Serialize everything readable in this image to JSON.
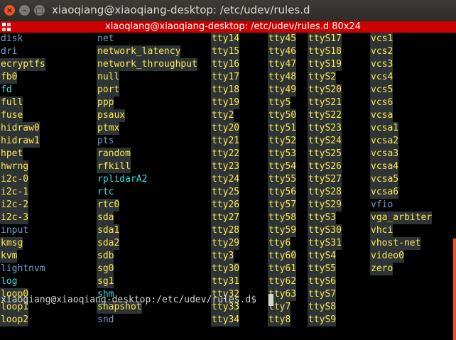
{
  "window": {
    "title": "xiaoqiang@xiaoqiang-desktop: /etc/udev/rules.d",
    "buttons": {
      "close": "×",
      "minimize": "–",
      "maximize": "□"
    }
  },
  "tmux": {
    "title": "xiaoqiang@xiaoqiang-desktop: /etc/udev/rules.d 80x24"
  },
  "listing": {
    "col1": [
      {
        "t": "disk",
        "k": "dir"
      },
      {
        "t": "dri",
        "k": "dir"
      },
      {
        "t": "ecryptfs",
        "k": "dev"
      },
      {
        "t": "fb0",
        "k": "dev"
      },
      {
        "t": "fd",
        "k": "lnk"
      },
      {
        "t": "full",
        "k": "dev"
      },
      {
        "t": "fuse",
        "k": "dev"
      },
      {
        "t": "hidraw0",
        "k": "dev"
      },
      {
        "t": "hidraw1",
        "k": "dev"
      },
      {
        "t": "hpet",
        "k": "dev"
      },
      {
        "t": "hwrng",
        "k": "dev"
      },
      {
        "t": "i2c-0",
        "k": "dev"
      },
      {
        "t": "i2c-1",
        "k": "dev"
      },
      {
        "t": "i2c-2",
        "k": "dev"
      },
      {
        "t": "i2c-3",
        "k": "dev"
      },
      {
        "t": "input",
        "k": "dir"
      },
      {
        "t": "kmsg",
        "k": "dev"
      },
      {
        "t": "kvm",
        "k": "dev"
      },
      {
        "t": "lightnvm",
        "k": "dir"
      },
      {
        "t": "log",
        "k": "lnk"
      },
      {
        "t": "loop0",
        "k": "dev"
      },
      {
        "t": "loop1",
        "k": "dev"
      },
      {
        "t": "loop2",
        "k": "dev"
      }
    ],
    "col2": [
      {
        "t": "net",
        "k": "dir"
      },
      {
        "t": "network_latency",
        "k": "dev"
      },
      {
        "t": "network_throughput",
        "k": "dev"
      },
      {
        "t": "null",
        "k": "dev"
      },
      {
        "t": "port",
        "k": "dev"
      },
      {
        "t": "ppp",
        "k": "dev"
      },
      {
        "t": "psaux",
        "k": "dev"
      },
      {
        "t": "ptmx",
        "k": "dev"
      },
      {
        "t": "pts",
        "k": "dir"
      },
      {
        "t": "random",
        "k": "dev"
      },
      {
        "t": "rfkill",
        "k": "dev"
      },
      {
        "t": "rplidarA2",
        "k": "lnk"
      },
      {
        "t": "rtc",
        "k": "lnk"
      },
      {
        "t": "rtc0",
        "k": "dev"
      },
      {
        "t": "sda",
        "k": "dev"
      },
      {
        "t": "sda1",
        "k": "dev"
      },
      {
        "t": "sda2",
        "k": "dev"
      },
      {
        "t": "sdb",
        "k": "dev"
      },
      {
        "t": "sg0",
        "k": "dev"
      },
      {
        "t": "sg1",
        "k": "dev"
      },
      {
        "t": "shm",
        "k": "lnk"
      },
      {
        "t": "snapshot",
        "k": "dev"
      },
      {
        "t": "snd",
        "k": "dir"
      }
    ],
    "col3": [
      {
        "t": "tty14",
        "k": "dev"
      },
      {
        "t": "tty15",
        "k": "dev"
      },
      {
        "t": "tty16",
        "k": "dev"
      },
      {
        "t": "tty17",
        "k": "dev"
      },
      {
        "t": "tty18",
        "k": "dev"
      },
      {
        "t": "tty19",
        "k": "dev"
      },
      {
        "t": "tty2",
        "k": "dev"
      },
      {
        "t": "tty20",
        "k": "dev"
      },
      {
        "t": "tty21",
        "k": "dev"
      },
      {
        "t": "tty22",
        "k": "dev"
      },
      {
        "t": "tty23",
        "k": "dev"
      },
      {
        "t": "tty24",
        "k": "dev"
      },
      {
        "t": "tty25",
        "k": "dev"
      },
      {
        "t": "tty26",
        "k": "dev"
      },
      {
        "t": "tty27",
        "k": "dev"
      },
      {
        "t": "tty28",
        "k": "dev"
      },
      {
        "t": "tty29",
        "k": "dev"
      },
      {
        "t": "tty3",
        "k": "dev"
      },
      {
        "t": "tty30",
        "k": "dev"
      },
      {
        "t": "tty31",
        "k": "dev"
      },
      {
        "t": "tty32",
        "k": "dev"
      },
      {
        "t": "tty33",
        "k": "dev"
      },
      {
        "t": "tty34",
        "k": "dev"
      }
    ],
    "col4": [
      {
        "t": "tty45",
        "k": "dev"
      },
      {
        "t": "tty46",
        "k": "dev"
      },
      {
        "t": "tty47",
        "k": "dev"
      },
      {
        "t": "tty48",
        "k": "dev"
      },
      {
        "t": "tty49",
        "k": "dev"
      },
      {
        "t": "tty5",
        "k": "dev"
      },
      {
        "t": "tty50",
        "k": "dev"
      },
      {
        "t": "tty51",
        "k": "dev"
      },
      {
        "t": "tty52",
        "k": "dev"
      },
      {
        "t": "tty53",
        "k": "dev"
      },
      {
        "t": "tty54",
        "k": "dev"
      },
      {
        "t": "tty55",
        "k": "dev"
      },
      {
        "t": "tty56",
        "k": "dev"
      },
      {
        "t": "tty57",
        "k": "dev"
      },
      {
        "t": "tty58",
        "k": "dev"
      },
      {
        "t": "tty59",
        "k": "dev"
      },
      {
        "t": "tty6",
        "k": "dev"
      },
      {
        "t": "tty60",
        "k": "dev"
      },
      {
        "t": "tty61",
        "k": "dev"
      },
      {
        "t": "tty62",
        "k": "dev"
      },
      {
        "t": "tty63",
        "k": "dev"
      },
      {
        "t": "tty7",
        "k": "dev"
      },
      {
        "t": "tty8",
        "k": "dev"
      }
    ],
    "col5": [
      {
        "t": "ttyS17",
        "k": "dev"
      },
      {
        "t": "ttyS18",
        "k": "dev"
      },
      {
        "t": "ttyS19",
        "k": "dev"
      },
      {
        "t": "ttyS2",
        "k": "dev"
      },
      {
        "t": "ttyS20",
        "k": "dev"
      },
      {
        "t": "ttyS21",
        "k": "dev"
      },
      {
        "t": "ttyS22",
        "k": "dev"
      },
      {
        "t": "ttyS23",
        "k": "dev"
      },
      {
        "t": "ttyS24",
        "k": "dev"
      },
      {
        "t": "ttyS25",
        "k": "dev"
      },
      {
        "t": "ttyS26",
        "k": "dev"
      },
      {
        "t": "ttyS27",
        "k": "dev"
      },
      {
        "t": "ttyS28",
        "k": "dev"
      },
      {
        "t": "ttyS29",
        "k": "dev"
      },
      {
        "t": "ttyS3",
        "k": "dev"
      },
      {
        "t": "ttyS30",
        "k": "dev"
      },
      {
        "t": "ttyS31",
        "k": "dev"
      },
      {
        "t": "ttyS4",
        "k": "dev"
      },
      {
        "t": "ttyS5",
        "k": "dev"
      },
      {
        "t": "ttyS6",
        "k": "dev"
      },
      {
        "t": "ttyS7",
        "k": "dev"
      },
      {
        "t": "ttyS8",
        "k": "dev"
      },
      {
        "t": "ttyS9",
        "k": "dev"
      }
    ],
    "col6": [
      {
        "t": "vcs1",
        "k": "dev"
      },
      {
        "t": "vcs2",
        "k": "dev"
      },
      {
        "t": "vcs3",
        "k": "dev"
      },
      {
        "t": "vcs4",
        "k": "dev"
      },
      {
        "t": "vcs5",
        "k": "dev"
      },
      {
        "t": "vcs6",
        "k": "dev"
      },
      {
        "t": "vcsa",
        "k": "dev"
      },
      {
        "t": "vcsa1",
        "k": "dev"
      },
      {
        "t": "vcsa2",
        "k": "dev"
      },
      {
        "t": "vcsa3",
        "k": "dev"
      },
      {
        "t": "vcsa4",
        "k": "dev"
      },
      {
        "t": "vcsa5",
        "k": "dev"
      },
      {
        "t": "vcsa6",
        "k": "dev"
      },
      {
        "t": "vfio",
        "k": "dir"
      },
      {
        "t": "vga_arbiter",
        "k": "dev"
      },
      {
        "t": "vhci",
        "k": "dev"
      },
      {
        "t": "vhost-net",
        "k": "dev"
      },
      {
        "t": "video0",
        "k": "dev"
      },
      {
        "t": "zero",
        "k": "dev"
      }
    ]
  },
  "prompt": "xiaoqiang@xiaoqiang-desktop:/etc/udev/rules.d$ ",
  "colors": {
    "directory": "#729fcf",
    "symlink": "#34e2e2",
    "device_fg": "#fce94f",
    "device_bg": "#2e3436",
    "tmux_bar": "#cc0000",
    "accent": "#e95420"
  }
}
